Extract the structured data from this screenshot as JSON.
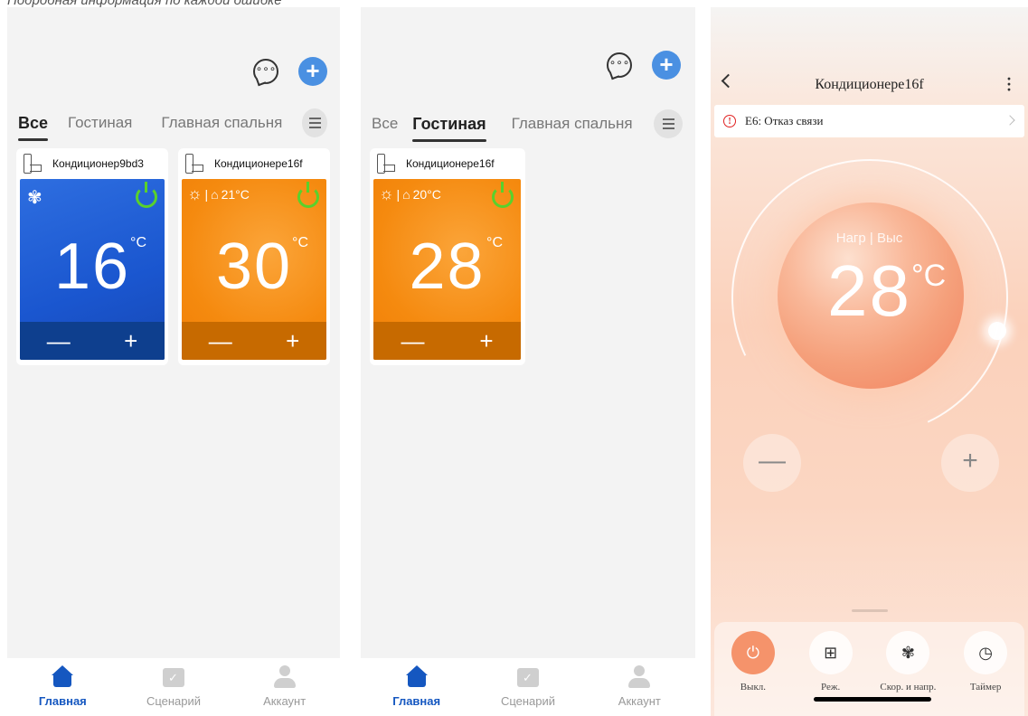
{
  "caption": "Подробная информация по каждой ошибке",
  "screen1": {
    "tabs": [
      {
        "label": "Все",
        "active": true
      },
      {
        "label": "Гостиная",
        "active": false
      },
      {
        "label": "Главная спальня",
        "active": false
      }
    ],
    "cards": [
      {
        "name": "Кондиционер9bd3",
        "temp": "16",
        "unit": "°C",
        "mode": "fan-icon",
        "color": "#1a56cf"
      },
      {
        "name": "Кондиционере16f",
        "temp": "30",
        "unit": "°C",
        "room_temp": "21°C",
        "mode": "sun-icon",
        "color": "#f58a0f"
      }
    ]
  },
  "screen2": {
    "tabs": [
      {
        "label": "Все",
        "active": false
      },
      {
        "label": "Гостиная",
        "active": true
      },
      {
        "label": "Главная спальня",
        "active": false
      }
    ],
    "cards": [
      {
        "name": "Кондиционере16f",
        "temp": "28",
        "unit": "°C",
        "room_temp": "20°C",
        "mode": "sun-icon",
        "color": "#f58a0f"
      }
    ]
  },
  "tabbar": {
    "home": "Главная",
    "scenario": "Сценарий",
    "account": "Аккаунт"
  },
  "screen3": {
    "title": "Кондиционере16f",
    "alert": "E6: Отказ связи",
    "mode": "Нагр | Выс",
    "temp": "28",
    "unit": "°C",
    "controls": {
      "power": "Выкл.",
      "mode": "Реж.",
      "speed": "Скор. и напр.",
      "timer": "Таймер"
    }
  },
  "colors": {
    "accent_blue": "#1557c0",
    "power_green": "#59d12c",
    "orange_tile": "#f58a0f",
    "blue_tile": "#1a56cf",
    "error_red": "#e02020"
  }
}
